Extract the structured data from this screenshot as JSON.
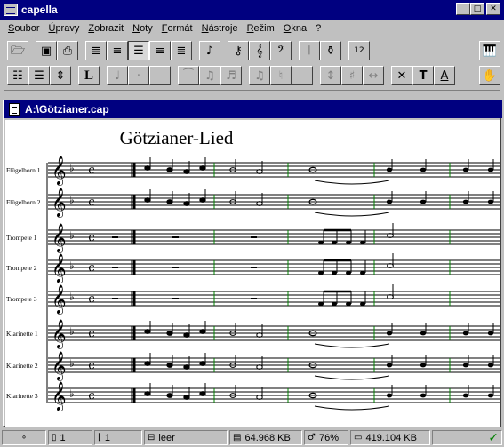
{
  "window": {
    "title": "capella"
  },
  "menu": [
    "Soubor",
    "Úpravy",
    "Zobrazit",
    "Noty",
    "Formát",
    "Nástroje",
    "Režim",
    "Okna",
    "?"
  ],
  "toolbar1": [
    {
      "icon": "open-folder-icon",
      "glyph": "🗁"
    },
    {
      "icon": "save-disk-icon",
      "glyph": "▣"
    },
    {
      "icon": "print-icon",
      "glyph": "⎙"
    },
    {
      "icon": "align-full-icon",
      "glyph": "≣"
    },
    {
      "icon": "align-left-icon",
      "glyph": "≡"
    },
    {
      "icon": "align-center-icon",
      "glyph": "☰",
      "pressed": true
    },
    {
      "icon": "align-right-icon",
      "glyph": "≡"
    },
    {
      "icon": "align-top-icon",
      "glyph": "≣"
    },
    {
      "icon": "rest-note-icon",
      "glyph": "♪"
    },
    {
      "icon": "key-icon",
      "glyph": "⚷"
    },
    {
      "icon": "treble-clef-icon",
      "glyph": "𝄞"
    },
    {
      "icon": "bass-clef-icon",
      "glyph": "𝄢"
    },
    {
      "icon": "barline-icon",
      "glyph": "𝄀"
    },
    {
      "icon": "stamp-icon",
      "glyph": "⚱"
    },
    {
      "icon": "page-number-icon",
      "glyph": "12"
    },
    {
      "icon": "midi-keyboard-icon",
      "glyph": "🎹"
    }
  ],
  "toolbar2": [
    {
      "icon": "staff-layout-icon",
      "glyph": "☷"
    },
    {
      "icon": "system-layout-icon",
      "glyph": "☰"
    },
    {
      "icon": "spacing-icon",
      "glyph": "⇕"
    },
    {
      "icon": "lyrics-L-icon",
      "glyph": "L"
    },
    {
      "icon": "note-dim-icon",
      "glyph": "♩",
      "dim": true
    },
    {
      "icon": "staccato-icon",
      "glyph": "·",
      "dim": true
    },
    {
      "icon": "tenuto-icon",
      "glyph": "–",
      "dim": true
    },
    {
      "icon": "tie-dim-icon",
      "glyph": "⁀",
      "dim": true
    },
    {
      "icon": "beam-dim-icon",
      "glyph": "♫",
      "dim": true
    },
    {
      "icon": "stem-dim-icon",
      "glyph": "♬",
      "dim": true
    },
    {
      "icon": "beam-group-icon",
      "glyph": "♫",
      "dim": true
    },
    {
      "icon": "flat-sharp-icon",
      "glyph": "♮",
      "dim": true
    },
    {
      "icon": "line-icon",
      "glyph": "—",
      "dim": true
    },
    {
      "icon": "transpose-icon",
      "glyph": "↕",
      "dim": true
    },
    {
      "icon": "accidentals-icon",
      "glyph": "♯",
      "dim": true
    },
    {
      "icon": "arrows-icon",
      "glyph": "↔",
      "dim": true
    },
    {
      "icon": "split-icon",
      "glyph": "✕"
    },
    {
      "icon": "text-T-icon",
      "glyph": "T"
    },
    {
      "icon": "text-A-icon",
      "glyph": "A"
    },
    {
      "icon": "hand-icon",
      "glyph": "✋"
    }
  ],
  "document": {
    "filename": "A:\\Götzianer.cap",
    "score_title": "Götzianer-Lied",
    "staves": [
      "Flügelhorn 1",
      "Flügelhorn 2",
      "Trompete 1",
      "Trompete 2",
      "Trompete 3",
      "Klarinette 1",
      "Klarinette 2",
      "Klarinette 3"
    ]
  },
  "status": {
    "page": "1",
    "bar": "1",
    "mode": "leer",
    "memory": "64.968 KB",
    "percent": "76%",
    "disk": "419.104 KB"
  },
  "colors": {
    "titlebar": "#000080",
    "barline_green": "#008000",
    "face": "#c0c0c0"
  }
}
